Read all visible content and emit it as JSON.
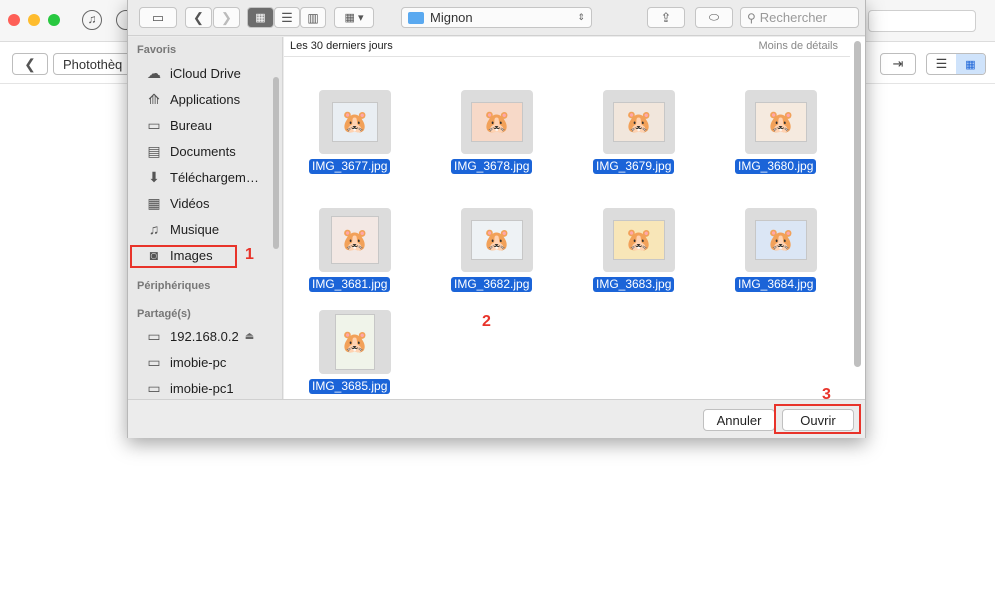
{
  "app": {
    "breadcrumb_label": "Photothèq"
  },
  "dialog": {
    "location": "Mignon",
    "search_placeholder": "Rechercher",
    "content_header": "Les 30 derniers jours",
    "less_details": "Moins de détails",
    "sidebar": {
      "favorites_title": "Favoris",
      "favorites": [
        {
          "label": "iCloud Drive",
          "icon": "cloud-icon"
        },
        {
          "label": "Applications",
          "icon": "applications-icon"
        },
        {
          "label": "Bureau",
          "icon": "desktop-icon"
        },
        {
          "label": "Documents",
          "icon": "documents-icon"
        },
        {
          "label": "Téléchargem…",
          "icon": "downloads-icon"
        },
        {
          "label": "Vidéos",
          "icon": "movies-icon"
        },
        {
          "label": "Musique",
          "icon": "music-icon"
        },
        {
          "label": "Images",
          "icon": "camera-icon"
        }
      ],
      "devices_title": "Périphériques",
      "shared_title": "Partagé(s)",
      "shared": [
        {
          "label": "192.168.0.2",
          "icon": "display-icon"
        },
        {
          "label": "imobie-pc",
          "icon": "display-icon"
        },
        {
          "label": "imobie-pc1",
          "icon": "display-icon"
        }
      ]
    },
    "files": [
      {
        "name": "IMG_3677.jpg",
        "selected": true
      },
      {
        "name": "IMG_3678.jpg",
        "selected": true
      },
      {
        "name": "IMG_3679.jpg",
        "selected": true
      },
      {
        "name": "IMG_3680.jpg",
        "selected": true
      },
      {
        "name": "IMG_3681.jpg",
        "selected": true
      },
      {
        "name": "IMG_3682.jpg",
        "selected": true
      },
      {
        "name": "IMG_3683.jpg",
        "selected": true
      },
      {
        "name": "IMG_3684.jpg",
        "selected": true
      },
      {
        "name": "IMG_3685.jpg",
        "selected": true
      }
    ],
    "cancel_label": "Annuler",
    "open_label": "Ouvrir"
  },
  "annotations": {
    "step1": "1",
    "step2": "2",
    "step3": "3",
    "color": "#e8332a"
  },
  "colors": {
    "selection": "#1b64d8",
    "accent_view": "#cfe3fb"
  }
}
